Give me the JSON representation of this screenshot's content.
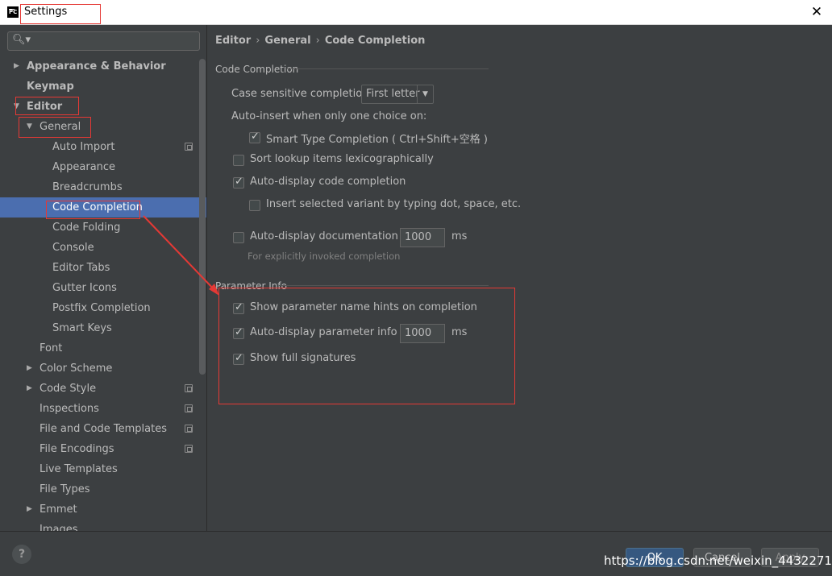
{
  "window": {
    "title": "Settings",
    "app_icon": "PC",
    "close_icon": "close-icon"
  },
  "search": {
    "icon": "search-icon",
    "placeholder": ""
  },
  "tree": [
    {
      "label": "Appearance & Behavior",
      "bold": true,
      "arrow": "▶",
      "expanded": false,
      "badge": false
    },
    {
      "label": "Keymap",
      "bold": true,
      "arrow": "",
      "badge": false
    },
    {
      "label": "Editor",
      "bold": true,
      "arrow": "▼",
      "expanded": true,
      "badge": false
    },
    {
      "label": "General",
      "bold": false,
      "arrow": "▼",
      "expanded": true,
      "badge": false
    },
    {
      "label": "Auto Import",
      "badge": true
    },
    {
      "label": "Appearance",
      "badge": false
    },
    {
      "label": "Breadcrumbs",
      "badge": false
    },
    {
      "label": "Code Completion",
      "badge": false,
      "selected": true
    },
    {
      "label": "Code Folding",
      "badge": false
    },
    {
      "label": "Console",
      "badge": false
    },
    {
      "label": "Editor Tabs",
      "badge": false
    },
    {
      "label": "Gutter Icons",
      "badge": false
    },
    {
      "label": "Postfix Completion",
      "badge": false
    },
    {
      "label": "Smart Keys",
      "badge": false
    },
    {
      "label": "Font",
      "badge": false
    },
    {
      "label": "Color Scheme",
      "arrow": "▶",
      "badge": false
    },
    {
      "label": "Code Style",
      "arrow": "▶",
      "badge": true
    },
    {
      "label": "Inspections",
      "badge": true
    },
    {
      "label": "File and Code Templates",
      "badge": true
    },
    {
      "label": "File Encodings",
      "badge": true
    },
    {
      "label": "Live Templates",
      "badge": false
    },
    {
      "label": "File Types",
      "badge": false
    },
    {
      "label": "Emmet",
      "arrow": "▶",
      "badge": false
    },
    {
      "label": "Images",
      "badge": false
    }
  ],
  "breadcrumb": [
    "Editor",
    "General",
    "Code Completion"
  ],
  "breadcrumb_sep": "›",
  "code_completion": {
    "section_title": "Code Completion",
    "case_sensitive_label": "Case sensitive completion:",
    "case_sensitive_value": "First letter",
    "auto_insert_label": "Auto-insert when only one choice on:",
    "options": [
      {
        "label": "Smart Type Completion ( Ctrl+Shift+空格 )",
        "checked": true
      },
      {
        "label": "Sort lookup items lexicographically",
        "checked": false
      },
      {
        "label": "Auto-display code completion",
        "checked": true
      },
      {
        "label": "Insert selected variant by typing dot, space, etc.",
        "checked": false
      },
      {
        "label": "Auto-display documentation in",
        "checked": false
      }
    ],
    "doc_delay_value": "1000",
    "doc_delay_unit": "ms",
    "doc_hint": "For explicitly invoked completion"
  },
  "parameter_info": {
    "section_title": "Parameter Info",
    "options": [
      {
        "label": "Show parameter name hints on completion",
        "checked": true
      },
      {
        "label": "Auto-display parameter info in",
        "checked": true
      },
      {
        "label": "Show full signatures",
        "checked": true
      }
    ],
    "delay_value": "1000",
    "delay_unit": "ms"
  },
  "buttons": {
    "ok": "OK",
    "cancel": "Cancel",
    "apply": "Apply"
  },
  "help_label": "?",
  "watermark": "https://blog.csdn.net/weixin_44322716",
  "colors": {
    "selection": "#4b6eaf",
    "annotation": "#e53935",
    "background": "#3c3f41"
  }
}
